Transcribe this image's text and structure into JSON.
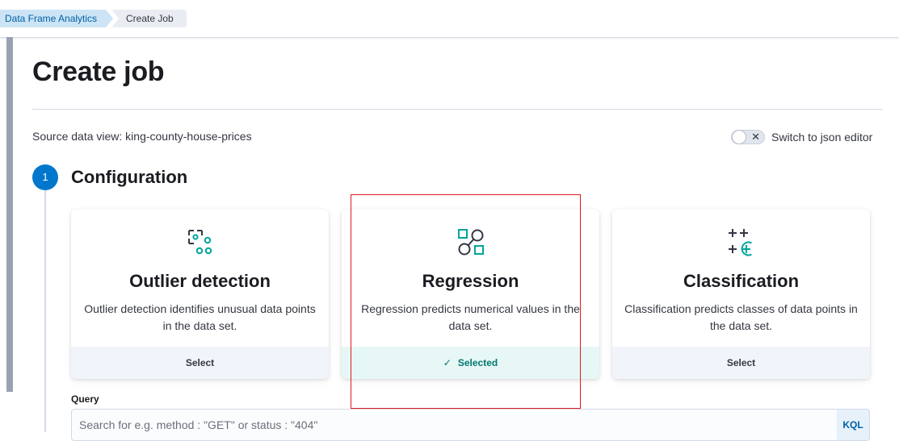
{
  "breadcrumbs": [
    {
      "label": "Data Frame Analytics"
    },
    {
      "label": "Create Job"
    }
  ],
  "page": {
    "title": "Create job",
    "source_data_view": "Source data view: king-county-house-prices",
    "json_editor_switch": {
      "label": "Switch to json editor",
      "checked": false
    }
  },
  "step": {
    "number": "1",
    "title": "Configuration"
  },
  "job_types": [
    {
      "icon": "outlier-detection-icon",
      "title": "Outlier detection",
      "description": "Outlier detection identifies unusual data points in the data set.",
      "action": "Select",
      "selected": false
    },
    {
      "icon": "regression-icon",
      "title": "Regression",
      "description": "Regression predicts numerical values in the data set.",
      "action": "Selected",
      "selected": true
    },
    {
      "icon": "classification-icon",
      "title": "Classification",
      "description": "Classification predicts classes of data points in the data set.",
      "action": "Select",
      "selected": false
    }
  ],
  "query": {
    "label": "Query",
    "placeholder": "Search for e.g. method : \"GET\" or status : \"404\"",
    "value": "",
    "language_button": "KQL"
  },
  "colors": {
    "accent": "#0077cc",
    "selected_text": "#007871",
    "selected_bg": "#e6f7f5",
    "icon_teal": "#00a69b",
    "highlight_box": "#e0191e"
  }
}
